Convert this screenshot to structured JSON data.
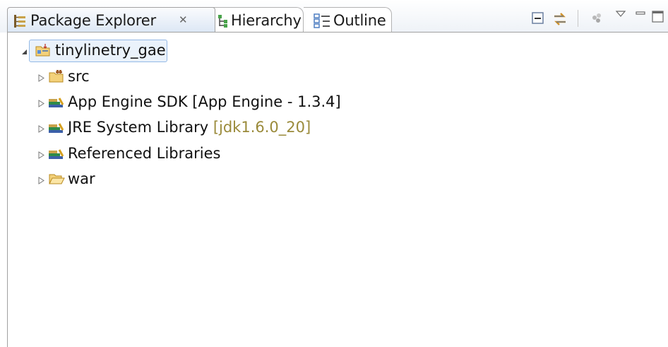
{
  "tabs": [
    {
      "label": "Package Explorer",
      "close": "✕",
      "icon": "package-explorer-icon",
      "active": true
    },
    {
      "label": "Hierarchy",
      "icon": "hierarchy-icon",
      "active": false
    },
    {
      "label": "Outline",
      "icon": "outline-icon",
      "active": false
    }
  ],
  "toolbar": {
    "icons": [
      "collapse-all-icon",
      "link-with-editor-icon",
      "focus-icon",
      "view-menu-icon",
      "minimize-icon",
      "maximize-icon"
    ]
  },
  "tree": {
    "root": {
      "label": "tinylinetry_gae",
      "icon": "java-project-icon",
      "expanded": true
    },
    "children": [
      {
        "label": "src",
        "decoration": "",
        "icon": "source-folder-icon"
      },
      {
        "label": "App Engine SDK [App Engine - 1.3.4]",
        "decoration": "",
        "icon": "library-icon"
      },
      {
        "label": "JRE System Library ",
        "decoration": "[jdk1.6.0_20]",
        "icon": "library-icon"
      },
      {
        "label": "Referenced Libraries",
        "decoration": "",
        "icon": "library-icon"
      },
      {
        "label": "war",
        "decoration": "",
        "icon": "folder-icon"
      }
    ]
  },
  "colors": {
    "selection_bg": "#eaf2fb",
    "selection_border": "#94b9e6",
    "decoration_text": "#9a8a3a",
    "accent": "#6fa1d8"
  }
}
